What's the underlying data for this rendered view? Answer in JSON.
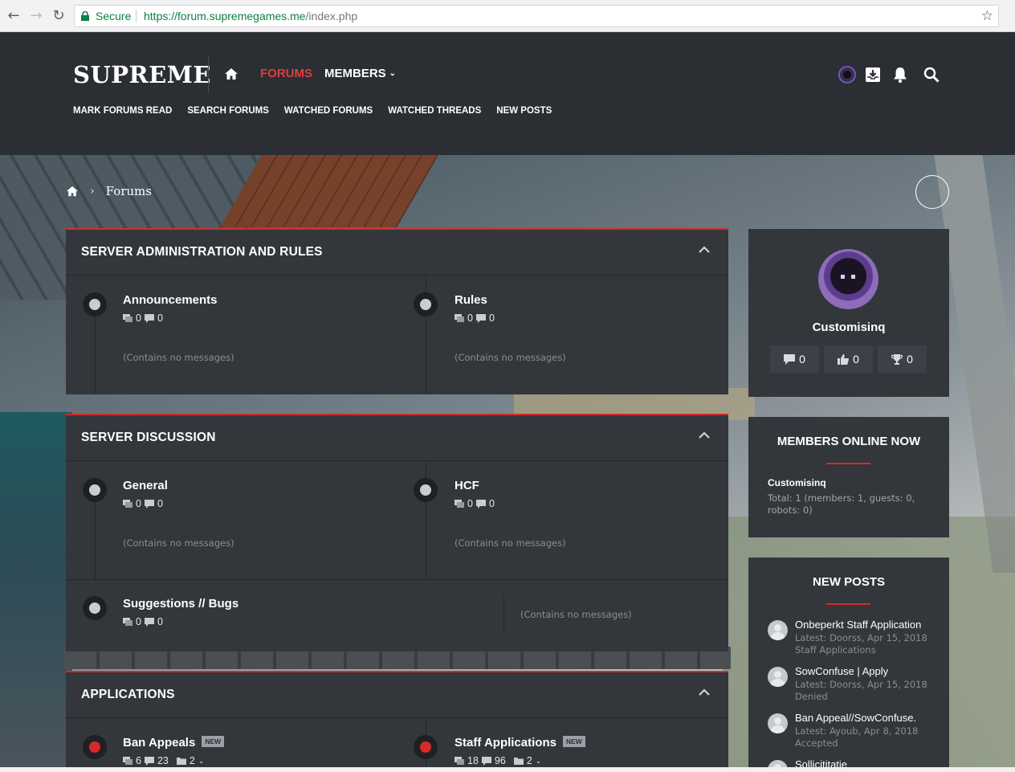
{
  "browser": {
    "secure_label": "Secure",
    "url_host": "https://forum.supremegames.me",
    "url_path": "/index.php",
    "icons": [
      "back-icon",
      "forward-icon",
      "reload-icon",
      "lock-icon",
      "star-icon"
    ]
  },
  "header": {
    "logo": "SUPREME",
    "nav": {
      "forums": "FORUMS",
      "members": "MEMBERS"
    },
    "subnav": [
      "MARK FORUMS READ",
      "SEARCH FORUMS",
      "WATCHED FORUMS",
      "WATCHED THREADS",
      "NEW POSTS"
    ],
    "icons": [
      "home-icon",
      "avatar",
      "inbox-icon",
      "bell-icon",
      "search-icon"
    ],
    "accent_color": "#e03c3c"
  },
  "breadcrumb": {
    "current": "Forums"
  },
  "categories": [
    {
      "title": "SERVER ADMINISTRATION AND RULES",
      "nodes": [
        {
          "title": "Announcements",
          "threads": "0",
          "messages": "0",
          "empty": "(Contains no messages)"
        },
        {
          "title": "Rules",
          "threads": "0",
          "messages": "0",
          "empty": "(Contains no messages)"
        }
      ]
    },
    {
      "title": "SERVER DISCUSSION",
      "nodes": [
        {
          "title": "General",
          "threads": "0",
          "messages": "0",
          "empty": "(Contains no messages)"
        },
        {
          "title": "HCF",
          "threads": "0",
          "messages": "0",
          "empty": "(Contains no messages)"
        },
        {
          "title": "Suggestions // Bugs",
          "threads": "0",
          "messages": "0",
          "empty": "(Contains no messages)"
        }
      ]
    },
    {
      "title": "APPLICATIONS",
      "nodes": [
        {
          "title": "Ban Appeals",
          "badge": "NEW",
          "threads": "6",
          "messages": "23",
          "subforums": "2"
        },
        {
          "title": "Staff Applications",
          "badge": "NEW",
          "threads": "18",
          "messages": "96",
          "subforums": "2"
        }
      ]
    }
  ],
  "sidebar": {
    "profile": {
      "name": "Customisinq",
      "messages": "0",
      "likes": "0",
      "trophies": "0"
    },
    "online": {
      "title": "MEMBERS ONLINE NOW",
      "member": "Customisinq",
      "total": "Total: 1 (members: 1, guests: 0, robots: 0)"
    },
    "new_posts": {
      "title": "NEW POSTS",
      "items": [
        {
          "title": "Onbeperkt Staff Application",
          "latest": "Latest: Doorss, Apr 15, 2018",
          "forum": "Staff Applications"
        },
        {
          "title": "SowConfuse | Apply",
          "latest": "Latest: Doorss, Apr 15, 2018",
          "forum": "Denied"
        },
        {
          "title": "Ban Appeal//SowConfuse.",
          "latest": "Latest: Ayoub, Apr 8, 2018",
          "forum": "Accepted"
        },
        {
          "title": "Sollicititatie"
        }
      ]
    }
  }
}
